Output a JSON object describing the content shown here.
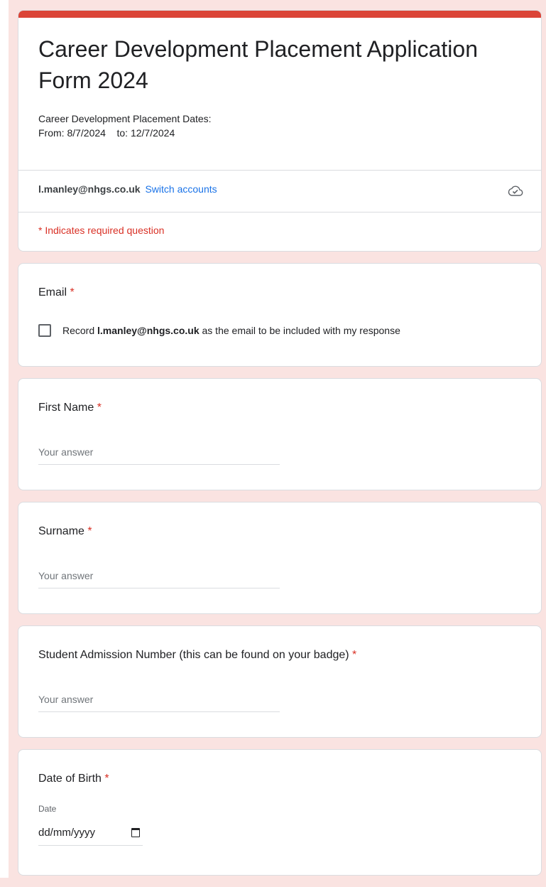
{
  "form": {
    "title": "Career Development Placement Application Form 2024",
    "description_line1": "Career Development Placement Dates:",
    "description_line2": "From: 8/7/2024    to: 12/7/2024",
    "account_email": "l.manley@nhgs.co.uk",
    "switch_accounts": "Switch accounts",
    "cloud_icon": "cloud-saved-icon",
    "required_notice": "* Indicates required question"
  },
  "email_question": {
    "label": "Email",
    "required_star": "*",
    "record_prefix": "Record",
    "record_email": "l.manley@nhgs.co.uk",
    "record_suffix": "as the email to be included with my response",
    "checked": false
  },
  "questions": [
    {
      "label": "First Name",
      "required_star": "*",
      "placeholder": "Your answer"
    },
    {
      "label": "Surname",
      "required_star": "*",
      "placeholder": "Your answer"
    },
    {
      "label": "Student Admission Number (this can be found on your badge)",
      "required_star": "*",
      "placeholder": "Your answer"
    }
  ],
  "dob": {
    "label": "Date of Birth",
    "required_star": "*",
    "date_label": "Date",
    "date_placeholder": "dd/mm/yyyy",
    "icon": "calendar-icon"
  },
  "colors": {
    "theme": "#db4437",
    "background": "#fae3e1",
    "link": "#1a73e8",
    "required": "#d93025"
  }
}
